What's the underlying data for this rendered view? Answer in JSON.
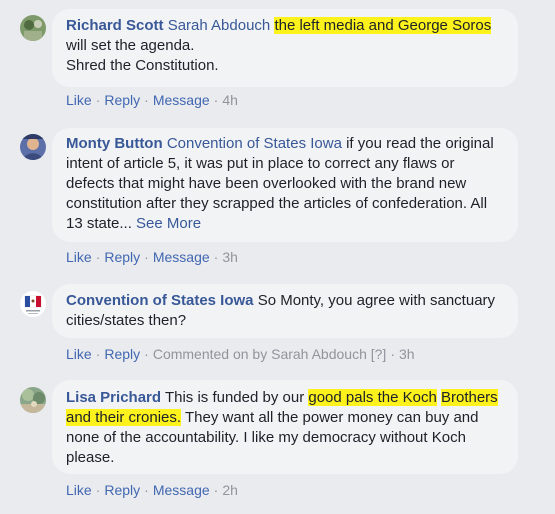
{
  "comments": [
    {
      "author": "Richard Scott",
      "text": {
        "tag": "Sarah Abdouch",
        "part1": "the left media and George Soros",
        "part2": " will set the agenda.",
        "line2": "Shred the Constitution."
      },
      "actions": {
        "like": "Like",
        "reply": "Reply",
        "message": "Message",
        "time": "4h"
      }
    },
    {
      "author": "Monty Button",
      "text": {
        "tag": "Convention of States Iowa",
        "body": " if you read the original intent of article 5, it was put in place to correct any flaws or defects that might have been overlooked with the brand new constitution after they scrapped the articles of confederation. All 13 state...",
        "see_more": "See More"
      },
      "actions": {
        "like": "Like",
        "reply": "Reply",
        "message": "Message",
        "time": "3h"
      }
    },
    {
      "author": "Convention of States Iowa",
      "text": {
        "body": "So Monty, you agree with sanctuary cities/states then?"
      },
      "actions": {
        "like": "Like",
        "reply": "Reply",
        "commented": "Commented on by Sarah Abdouch",
        "help": "[?]",
        "time": "3h"
      }
    },
    {
      "author": "Lisa Prichard",
      "text": {
        "part1": "This is funded by our ",
        "highlight1": "good pals the Koch",
        "highlight2": "Brothers and their cronies.",
        "part2": " They want all the power money can buy and none of the accountability. I like my democracy without Koch please."
      },
      "actions": {
        "like": "Like",
        "reply": "Reply",
        "message": "Message",
        "time": "2h"
      }
    }
  ],
  "colors": {
    "link": "#385898",
    "highlight": "#fdf21b",
    "bubble": "#f2f3f5",
    "background": "#e9ebee"
  }
}
